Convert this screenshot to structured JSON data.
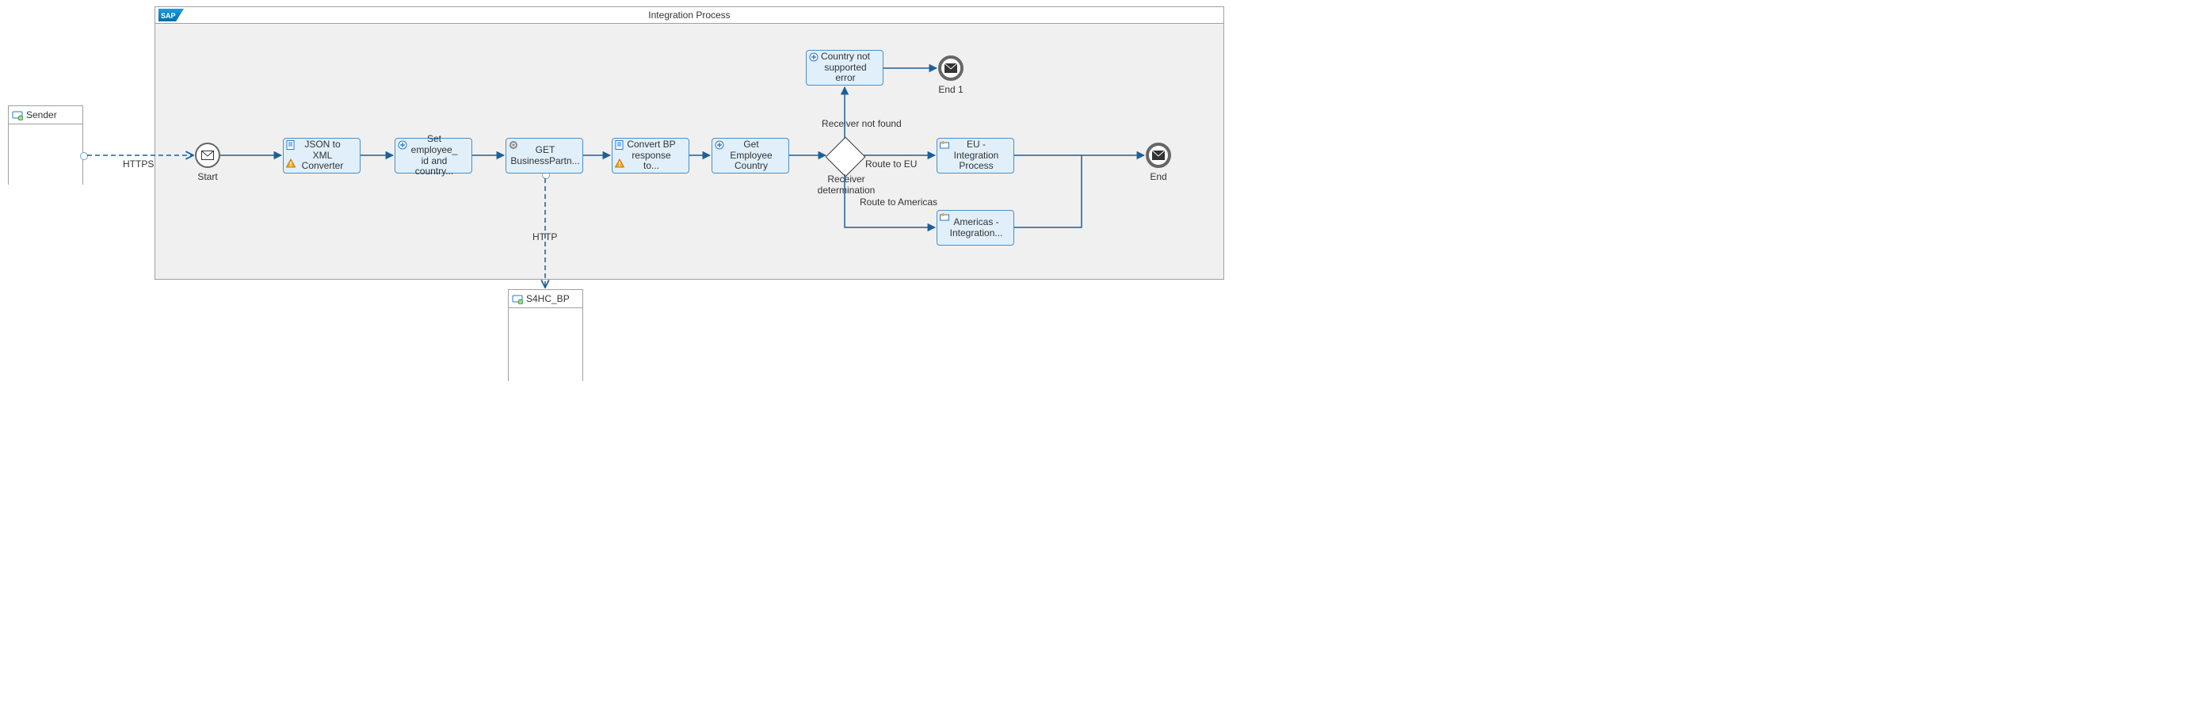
{
  "pool": {
    "title": "Integration Process"
  },
  "sender": {
    "title": "Sender"
  },
  "receiver_bp": {
    "title": "S4HC_BP"
  },
  "events": {
    "start": "Start",
    "end1": "End 1",
    "end": "End"
  },
  "tasks": {
    "json2xml": "JSON to XML Converter",
    "set_emp": "Set employee_ id and country...",
    "get_bp": "GET BusinessPartn...",
    "convert_bp": "Convert BP response to...",
    "get_country": "Get Employee Country",
    "err": "Country not supported error",
    "eu": "EU - Integration Process",
    "am": "Americas - Integration..."
  },
  "gateway": {
    "label": "Receiver determination"
  },
  "edges": {
    "https": "HTTPS",
    "http": "HTTP",
    "not_found": "Receiver not found",
    "route_eu": "Route to EU",
    "route_am": "Route to Americas"
  },
  "sap_logo": "SAP"
}
